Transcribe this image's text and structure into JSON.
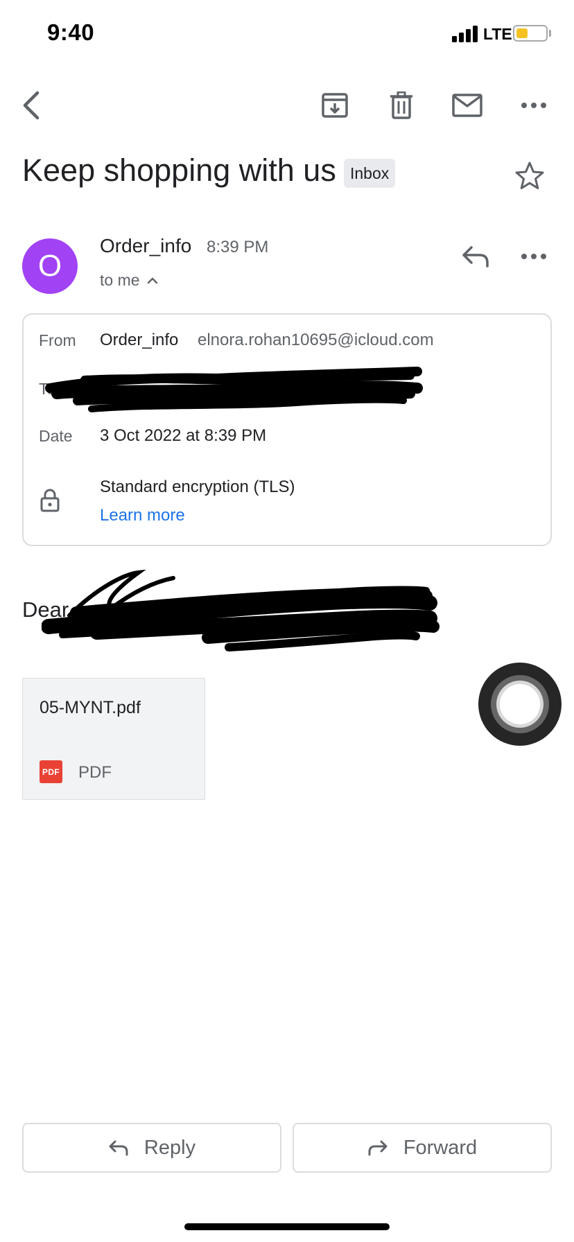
{
  "status_bar": {
    "time": "9:40",
    "network": "LTE",
    "battery_level": 0.4,
    "battery_color": "#f6c223"
  },
  "toolbar": {
    "back_icon": "chevron-left-icon",
    "archive_icon": "archive-icon",
    "delete_icon": "trash-icon",
    "mark_unread_icon": "mail-icon",
    "more_icon": "more-horizontal-icon"
  },
  "email": {
    "subject": "Keep shopping with us",
    "label": "Inbox",
    "star_icon": "star-outline-icon",
    "sender": {
      "avatar_letter": "O",
      "avatar_color": "#a142f4",
      "name": "Order_info",
      "time": "8:39 PM",
      "recipient_summary": "to me"
    },
    "details": {
      "from_label": "From",
      "from_name": "Order_info",
      "from_address": "elnora.rohan10695@icloud.com",
      "to_label": "To",
      "date_label": "Date",
      "date_value": "3 Oct 2022 at 8:39 PM",
      "encryption_text": "Standard encryption (TLS)",
      "learn_more": "Learn more"
    },
    "body_greeting": "Dear",
    "attachment": {
      "name": "05-MYNT.pdf",
      "type_badge": "PDF",
      "type_label": "PDF"
    }
  },
  "actions": {
    "reply_label": "Reply",
    "forward_label": "Forward"
  },
  "colors": {
    "accent_link": "#1a73e8",
    "text_primary": "#202124",
    "text_secondary": "#5f6368",
    "pdf_red": "#e94235"
  }
}
